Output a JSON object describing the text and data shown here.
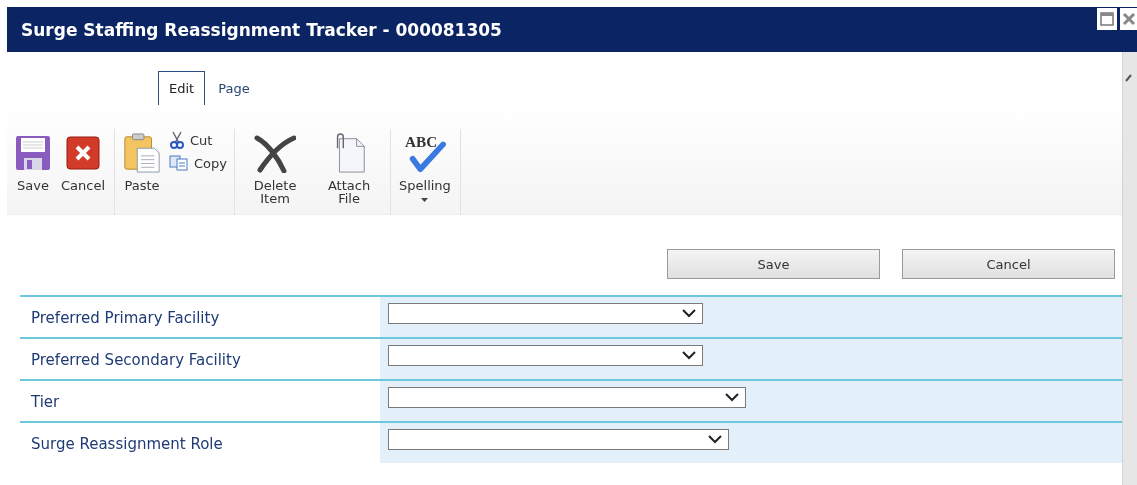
{
  "window": {
    "title": "Surge Staffing Reassignment Tracker - 000081305"
  },
  "tabs": [
    {
      "label": "Edit",
      "selected": true
    },
    {
      "label": "Page",
      "selected": false
    }
  ],
  "ribbon_groups": [
    {
      "items": [
        {
          "kind": "large",
          "label": "Save"
        },
        {
          "kind": "large",
          "label": "Cancel"
        }
      ]
    },
    {
      "items": [
        {
          "kind": "large",
          "label": "Paste"
        },
        {
          "kind": "stack",
          "items": [
            {
              "label": "Cut"
            },
            {
              "label": "Copy"
            }
          ]
        }
      ]
    },
    {
      "items": [
        {
          "kind": "large",
          "label": "Delete Item"
        },
        {
          "kind": "large",
          "label": "Attach File"
        }
      ]
    },
    {
      "items": [
        {
          "kind": "large",
          "label": "Spelling",
          "icon_text": "ABC",
          "menu": true
        }
      ]
    }
  ],
  "form_buttons": [
    "Save",
    "Cancel"
  ],
  "fields": [
    {
      "label": "Preferred Primary Facility",
      "kind": "dropdown"
    },
    {
      "label": "Preferred Secondary Facility",
      "kind": "dropdown"
    },
    {
      "label": "Tier",
      "kind": "dropdown"
    },
    {
      "label": "Surge Reassignment Role",
      "kind": "dropdown"
    }
  ]
}
